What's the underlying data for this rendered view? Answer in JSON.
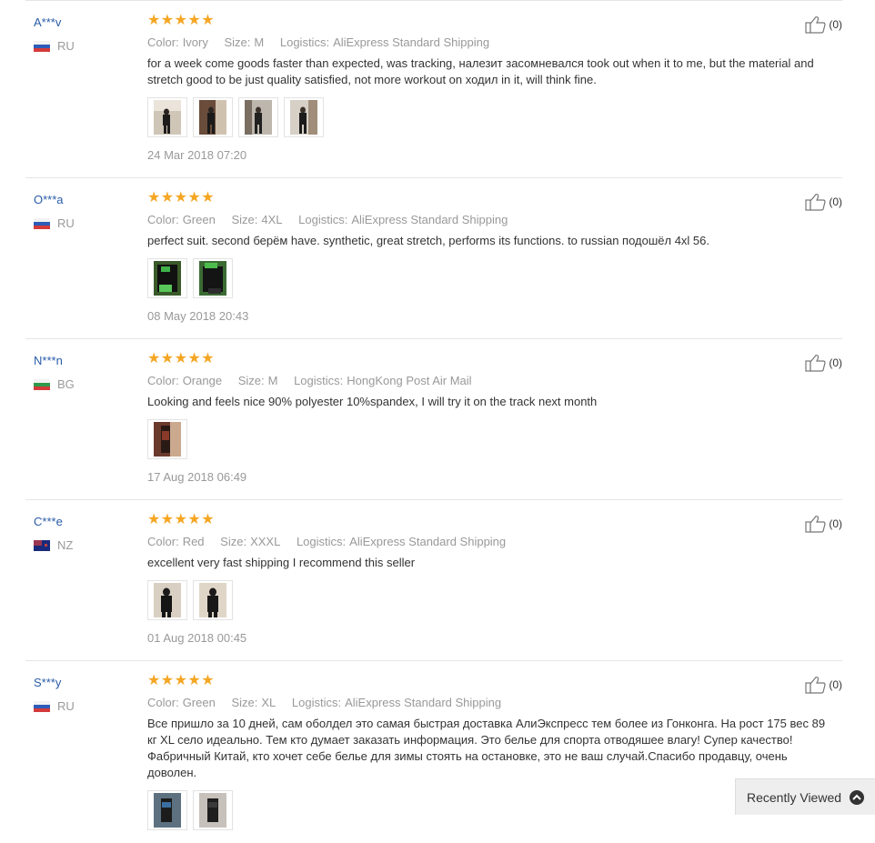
{
  "labels": {
    "color": "Color:",
    "size": "Size:",
    "logistics": "Logistics:"
  },
  "reviews": [
    {
      "user": "A***v",
      "country": "RU",
      "color": "Ivory",
      "size": "M",
      "logistics": "AliExpress Standard Shipping",
      "text": "for a week come goods faster than expected, was tracking, налезит засомневался took out when it to me, but the material and stretch good to be just quality satisfied, not more workout on ходил in it, will think fine.",
      "date": "24 Mar 2018 07:20",
      "helpful": "(0)",
      "photos": 4
    },
    {
      "user": "O***a",
      "country": "RU",
      "color": "Green",
      "size": "4XL",
      "logistics": "AliExpress Standard Shipping",
      "text": "perfect suit. second берём have. synthetic, great stretch, performs its functions. to russian подошёл 4xl 56.",
      "date": "08 May 2018 20:43",
      "helpful": "(0)",
      "photos": 2
    },
    {
      "user": "N***n",
      "country": "BG",
      "color": "Orange",
      "size": "M",
      "logistics": "HongKong Post Air Mail",
      "text": "Looking and feels nice 90% polyester 10%spandex, I will try it on the track next month",
      "date": "17 Aug 2018 06:49",
      "helpful": "(0)",
      "photos": 1
    },
    {
      "user": "C***e",
      "country": "NZ",
      "color": "Red",
      "size": "XXXL",
      "logistics": "AliExpress Standard Shipping",
      "text": "excellent very fast shipping I recommend this seller",
      "date": "01 Aug 2018 00:45",
      "helpful": "(0)",
      "photos": 2
    },
    {
      "user": "S***y",
      "country": "RU",
      "color": "Green",
      "size": "XL",
      "logistics": "AliExpress Standard Shipping",
      "text": "Все пришло за 10 дней, сам оболдел это самая быстрая доставка АлиЭкспресс тем более из Гонконга. На рост 175 вес 89 кг XL село идеально. Тем кто думает заказать информация. Это белье для спорта отводяшее влагу! Супер качество! Фабричный Китай, кто хочет себе белье для зимы стоять на остановке, это не ваш случай.Спасибо продавцу, очень доволен.",
      "date": "",
      "helpful": "(0)",
      "photos": 2
    }
  ],
  "recently_viewed": {
    "label": "Recently Viewed",
    "icon": "chevron-up-icon"
  },
  "colors": {
    "star": "#f5a623",
    "user_link": "#2a5ba8",
    "meta": "#999999"
  }
}
